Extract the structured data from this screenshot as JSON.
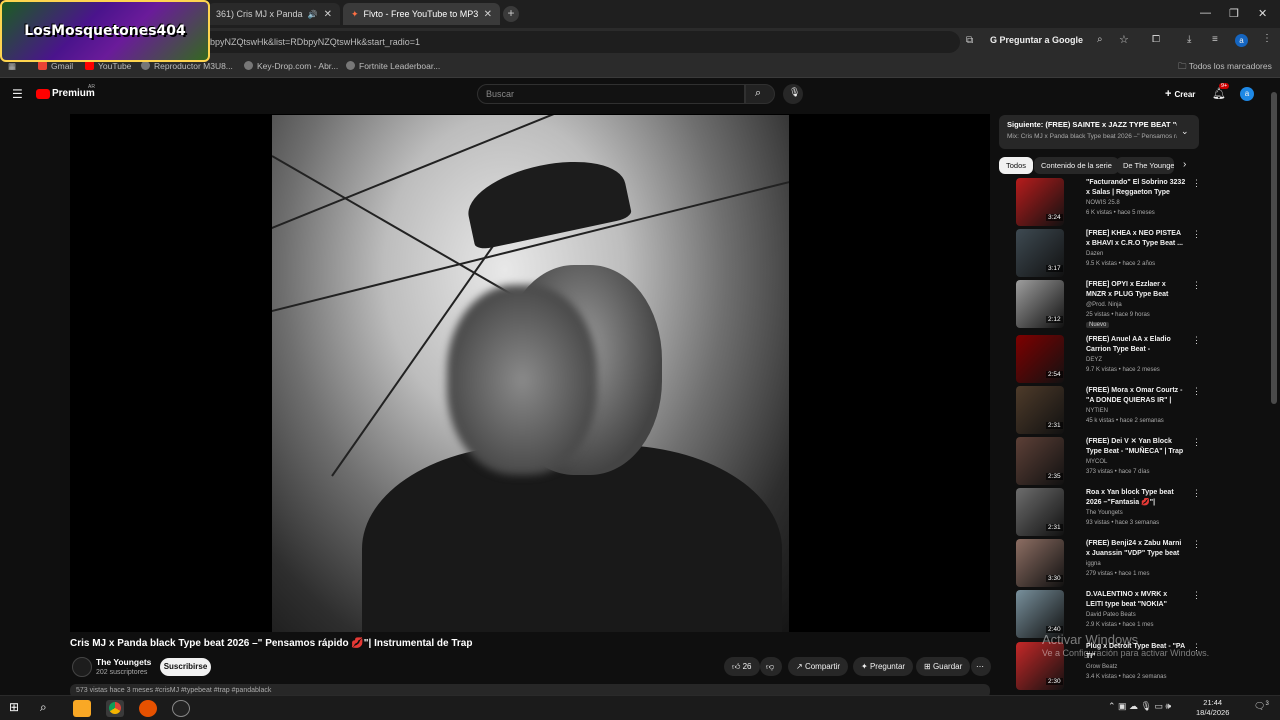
{
  "browser": {
    "tabs": [
      {
        "label": "361) Cris MJ x Panda black"
      },
      {
        "label": "Flvto - Free YouTube to MP3 C"
      }
    ],
    "address": "bpyNZQtswHk&list=RDbpyNZQtswHk&start_radio=1",
    "ask_google": "Preguntar a Google",
    "bookmarks": [
      "Gmail",
      "YouTube",
      "Reproductor M3U8...",
      "Key-Drop.com - Abr...",
      "Fortnite Leaderboar..."
    ],
    "all_bookmarks": "Todos los marcadores"
  },
  "overlay_logo": "LosMosquetones404",
  "youtube": {
    "logo_text": "Premium",
    "logo_badge": "AR",
    "search_placeholder": "Buscar",
    "create_label": "Crear",
    "notif_count": "9+",
    "avatar_letter": "a"
  },
  "video": {
    "title": "Cris MJ x Panda black Type beat 2026 –\" Pensamos rápido 💋\"| Instrumental de Trap",
    "channel": "The Youngets",
    "subscribers": "202 suscriptores",
    "subscribe_label": "Suscribirse",
    "likes": "26",
    "share_label": "Compartir",
    "ask_label": "Preguntar",
    "save_label": "Guardar",
    "description_peek": "573 vistas  hace 3 meses  #crisMJ #typebeat #trap #pandablack"
  },
  "sidebar": {
    "next_title": "Siguiente: (FREE) SAINTE x JAZZ TYPE BEAT \"GRO...",
    "next_sub": "Mix: Cris MJ x Panda black Type beat 2026 –\" Pensamos rá...",
    "chips": [
      "Todos",
      "Contenido de la serie",
      "De The Youngets"
    ],
    "items": [
      {
        "title": "\"Facturando\" El Sobrino 3232 x Salas | Reggaeton Type Beat 🔴",
        "channel": "NOWIS 25.8",
        "meta": "6 K vistas • hace 5 meses",
        "duration": "3:24",
        "color": "#b71c1c"
      },
      {
        "title": "[FREE] KHEA x NEO PISTEA x BHAVI x C.R.O Type Beat ...",
        "channel": "Dazen",
        "meta": "9.5 K vistas • hace 2 años",
        "duration": "3:17",
        "color": "#3e4a52"
      },
      {
        "title": "[FREE] OPYI x Ezzlaer x MNZR x PLUG Type Beat \"Cinta\"",
        "channel": "@Prod. Ninja",
        "meta": "25 vistas • hace 9 horas",
        "duration": "2:12",
        "color": "#9e9e9e",
        "badge": "Nuevo"
      },
      {
        "title": "(FREE) Anuel AA x Eladio Carrion Type Beat - \"PROFECÍ...",
        "channel": "DEYZ",
        "meta": "9.7 K vistas • hace 2 meses",
        "duration": "2:54",
        "color": "#7f0000"
      },
      {
        "title": "(FREE) Mora x Omar Courtz - \"A DONDE QUIERAS IR\" | Trap/R&...",
        "channel": "NYTIEN",
        "meta": "45 k vistas • hace 2 semanas",
        "duration": "2:31",
        "color": "#4e3b2a"
      },
      {
        "title": "(FREE) Dei V ✕ Yan Block Type Beat - \"MUÑECA\" | Trap melodi...",
        "channel": "MYCOL",
        "meta": "373 vistas • hace 7 días",
        "duration": "2:35",
        "color": "#5d4037"
      },
      {
        "title": "Roa x Yan block Type beat 2026 –\"Fantasia 💋\"| Instrumental d...",
        "channel": "The Youngets",
        "meta": "93 vistas • hace 3 semanas",
        "duration": "2:31",
        "color": "#6d6d6d"
      },
      {
        "title": "(FREE) Benji24 x Zabu Marni x Juanssin \"VDP\" Type beat",
        "channel": "iggna",
        "meta": "279 vistas • hace 1 mes",
        "duration": "3:30",
        "color": "#8d6e63"
      },
      {
        "title": "D.VALENTINO x MVRK x LEITI type beat \"NOKIA\"",
        "channel": "David Pateo Beats",
        "meta": "2.9 K vistas • hace 1 mes",
        "duration": "2:40",
        "color": "#78909c"
      },
      {
        "title": "Plug x Detroit Type Beat - \"PA TI\"",
        "channel": "Grow Beatz",
        "meta": "3.4 K vistas • hace 2 semanas",
        "duration": "2:30",
        "color": "#c62828"
      }
    ]
  },
  "watermark": {
    "line1": "Activar Windows",
    "line2": "Ve a Configuración para activar Windows."
  },
  "taskbar": {
    "time": "21:44",
    "date": "18/4/2026",
    "notif": "3"
  }
}
